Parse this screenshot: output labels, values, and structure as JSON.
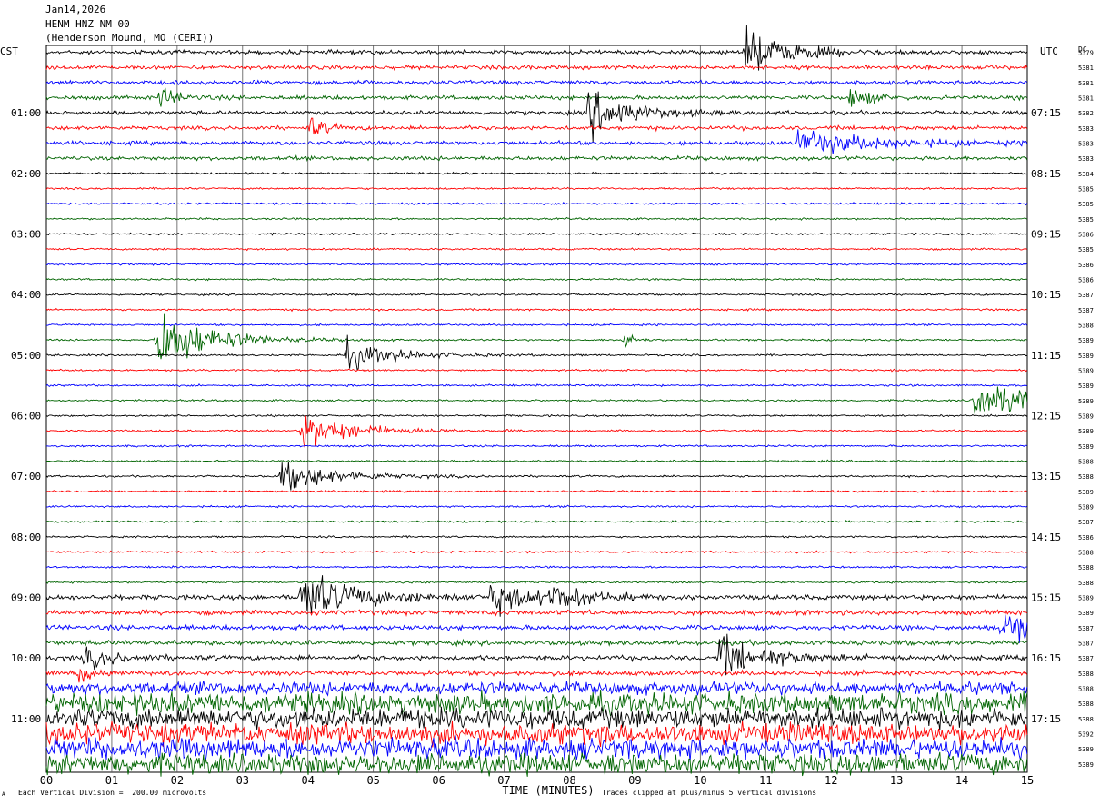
{
  "header": {
    "date": "Jan14,2026",
    "station": "HENM HNZ NM 00",
    "location": "(Henderson Mound, MO (CERI))"
  },
  "left_axis_title": "CST",
  "right_axis_title": "UTC",
  "dc_title": "DC",
  "footer": {
    "scale_note": "Each Vertical Division =  200.00 microvolts",
    "clip_note": "Traces clipped at plus/minus 5 vertical divisions",
    "corner_mark": "A"
  },
  "chart_data": {
    "type": "line",
    "title": "HENM HNZ NM 00",
    "xlabel": "TIME (MINUTES)",
    "ylabel": "",
    "xlim": [
      0,
      15
    ],
    "x_ticks": [
      "00",
      "01",
      "02",
      "03",
      "04",
      "05",
      "06",
      "07",
      "08",
      "09",
      "10",
      "11",
      "12",
      "13",
      "14",
      "15"
    ],
    "rows": 48,
    "minutes_per_row": 15,
    "trace_colors": [
      "#000000",
      "#ff0000",
      "#0000ff",
      "#006400"
    ],
    "left_time_labels": [
      {
        "row": 4,
        "label": "01:00"
      },
      {
        "row": 8,
        "label": "02:00"
      },
      {
        "row": 12,
        "label": "03:00"
      },
      {
        "row": 16,
        "label": "04:00"
      },
      {
        "row": 20,
        "label": "05:00"
      },
      {
        "row": 24,
        "label": "06:00"
      },
      {
        "row": 28,
        "label": "07:00"
      },
      {
        "row": 32,
        "label": "08:00"
      },
      {
        "row": 36,
        "label": "09:00"
      },
      {
        "row": 40,
        "label": "10:00"
      },
      {
        "row": 44,
        "label": "11:00"
      }
    ],
    "right_time_labels": [
      {
        "row": 4,
        "label": "07:15"
      },
      {
        "row": 8,
        "label": "08:15"
      },
      {
        "row": 12,
        "label": "09:15"
      },
      {
        "row": 16,
        "label": "10:15"
      },
      {
        "row": 20,
        "label": "11:15"
      },
      {
        "row": 24,
        "label": "12:15"
      },
      {
        "row": 28,
        "label": "13:15"
      },
      {
        "row": 32,
        "label": "14:15"
      },
      {
        "row": 36,
        "label": "15:15"
      },
      {
        "row": 40,
        "label": "16:15"
      },
      {
        "row": 44,
        "label": "17:15"
      }
    ],
    "dc_offsets": [
      "5379",
      "5381",
      "5381",
      "5381",
      "5382",
      "5383",
      "5383",
      "5383",
      "5384",
      "5385",
      "5385",
      "5385",
      "5386",
      "5385",
      "5386",
      "5386",
      "5387",
      "5387",
      "5388",
      "5389",
      "5389",
      "5389",
      "5389",
      "5389",
      "5389",
      "5389",
      "5389",
      "5388",
      "5388",
      "5389",
      "5389",
      "5387",
      "5386",
      "5388",
      "5388",
      "5388",
      "5389",
      "5389",
      "5387",
      "5387",
      "5387",
      "5388",
      "5388",
      "5388",
      "5388",
      "5392",
      "5389",
      "5389"
    ],
    "events": [
      {
        "row": 0,
        "minute": 10.7,
        "amp": 2.8,
        "dur": 0.6
      },
      {
        "row": 3,
        "minute": 1.75,
        "amp": 1.4,
        "dur": 0.25
      },
      {
        "row": 3,
        "minute": 12.3,
        "amp": 1.4,
        "dur": 0.3
      },
      {
        "row": 4,
        "minute": 8.3,
        "amp": 3.0,
        "dur": 0.6
      },
      {
        "row": 5,
        "minute": 4.05,
        "amp": 1.4,
        "dur": 0.2
      },
      {
        "row": 6,
        "minute": 11.5,
        "amp": 1.5,
        "dur": 1.2
      },
      {
        "row": 19,
        "minute": 1.7,
        "amp": 4.5,
        "dur": 0.7
      },
      {
        "row": 19,
        "minute": 8.85,
        "amp": 2.0,
        "dur": 0.1
      },
      {
        "row": 20,
        "minute": 4.6,
        "amp": 1.8,
        "dur": 0.7
      },
      {
        "row": 23,
        "minute": 14.2,
        "amp": 2.2,
        "dur": 1.4
      },
      {
        "row": 25,
        "minute": 3.9,
        "amp": 2.2,
        "dur": 0.8
      },
      {
        "row": 28,
        "minute": 3.6,
        "amp": 2.0,
        "dur": 0.8
      },
      {
        "row": 36,
        "minute": 3.9,
        "amp": 3.2,
        "dur": 0.8
      },
      {
        "row": 36,
        "minute": 6.8,
        "amp": 2.0,
        "dur": 0.6
      },
      {
        "row": 36,
        "minute": 7.7,
        "amp": 1.6,
        "dur": 0.5
      },
      {
        "row": 38,
        "minute": 14.6,
        "amp": 2.4,
        "dur": 0.8
      },
      {
        "row": 40,
        "minute": 10.3,
        "amp": 2.6,
        "dur": 0.7
      },
      {
        "row": 40,
        "minute": 0.6,
        "amp": 1.2,
        "dur": 0.5
      },
      {
        "row": 41,
        "minute": 0.5,
        "amp": 1.2,
        "dur": 0.2
      }
    ],
    "noise_profile": [
      {
        "row_from": 0,
        "row_to": 7,
        "level": 0.25
      },
      {
        "row_from": 8,
        "row_to": 35,
        "level": 0.12
      },
      {
        "row_from": 36,
        "row_to": 41,
        "level": 0.3
      },
      {
        "row_from": 42,
        "row_to": 42,
        "level": 0.8
      },
      {
        "row_from": 43,
        "row_to": 47,
        "level": 1.3
      }
    ]
  }
}
